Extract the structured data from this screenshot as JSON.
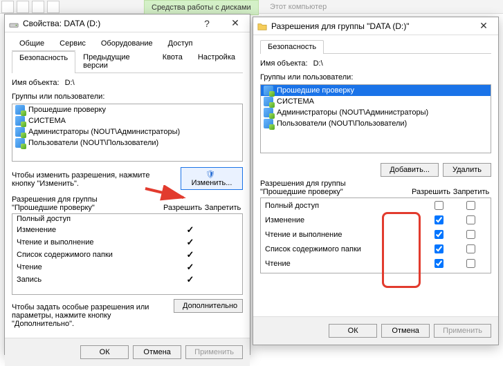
{
  "toolbar": {
    "ribbon1": "Средства работы с дисками",
    "ribbon2": "Этот компьютер"
  },
  "win1": {
    "title": "Свойства: DATA (D:)",
    "tabs1": [
      "Общие",
      "Сервис",
      "Оборудование",
      "Доступ"
    ],
    "tabs2": [
      "Безопасность",
      "Предыдущие версии",
      "Квота",
      "Настройка"
    ],
    "activeTab": "Безопасность",
    "object_label": "Имя объекта:",
    "object_value": "D:\\",
    "groups_label": "Группы или пользователи:",
    "groups": [
      "Прошедшие проверку",
      "СИСТЕМА",
      "Администраторы (NOUT\\Администраторы)",
      "Пользователи (NOUT\\Пользователи)"
    ],
    "change_hint": "Чтобы изменить разрешения, нажмите кнопку \"Изменить\".",
    "change_btn": "Изменить...",
    "perm_title_line1": "Разрешения для группы",
    "perm_title_line2": "\"Прошедшие проверку\"",
    "allow": "Разрешить",
    "deny": "Запретить",
    "perms": [
      {
        "name": "Полный доступ",
        "allow": false,
        "deny": false
      },
      {
        "name": "Изменение",
        "allow": true,
        "deny": false
      },
      {
        "name": "Чтение и выполнение",
        "allow": true,
        "deny": false
      },
      {
        "name": "Список содержимого папки",
        "allow": true,
        "deny": false
      },
      {
        "name": "Чтение",
        "allow": true,
        "deny": false
      },
      {
        "name": "Запись",
        "allow": true,
        "deny": false
      }
    ],
    "adv_hint": "Чтобы задать особые разрешения или параметры, нажмите кнопку \"Дополнительно\".",
    "adv_btn": "Дополнительно",
    "ok": "ОК",
    "cancel": "Отмена",
    "apply": "Применить"
  },
  "win2": {
    "title": "Разрешения для группы \"DATA (D:)\"",
    "tab": "Безопасность",
    "object_label": "Имя объекта:",
    "object_value": "D:\\",
    "groups_label": "Группы или пользователи:",
    "groups": [
      "Прошедшие проверку",
      "СИСТЕМА",
      "Администраторы (NOUT\\Администраторы)",
      "Пользователи (NOUT\\Пользователи)"
    ],
    "add_btn": "Добавить...",
    "remove_btn": "Удалить",
    "perm_title_line1": "Разрешения для группы",
    "perm_title_line2": "\"Прошедшие проверку\"",
    "allow": "Разрешить",
    "deny": "Запретить",
    "perms": [
      {
        "name": "Полный доступ",
        "allow": false,
        "deny": false
      },
      {
        "name": "Изменение",
        "allow": true,
        "deny": false
      },
      {
        "name": "Чтение и выполнение",
        "allow": true,
        "deny": false
      },
      {
        "name": "Список содержимого папки",
        "allow": true,
        "deny": false
      },
      {
        "name": "Чтение",
        "allow": true,
        "deny": false
      }
    ],
    "ok": "ОК",
    "cancel": "Отмена",
    "apply": "Применить"
  }
}
